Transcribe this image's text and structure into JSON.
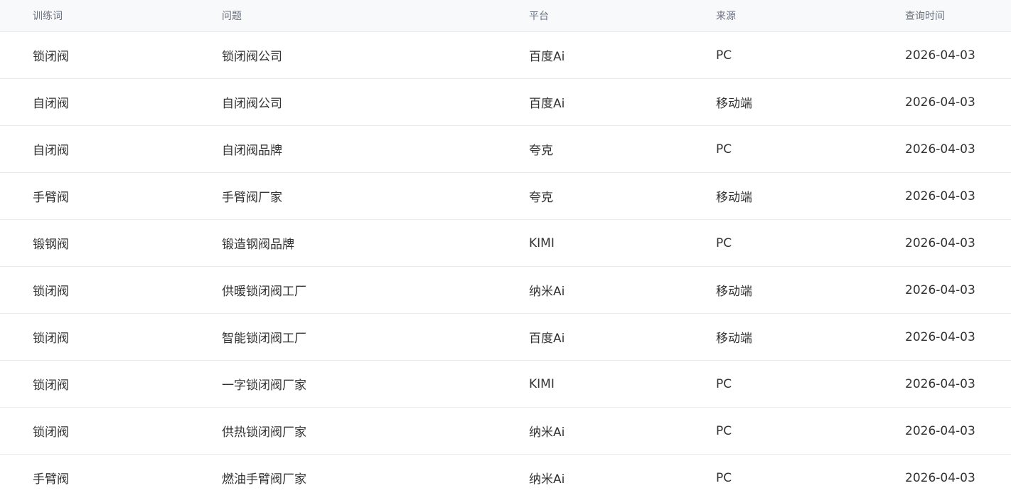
{
  "table": {
    "headers": [
      "训练词",
      "问题",
      "平台",
      "来源",
      "查询时间"
    ],
    "rows": [
      [
        "锁闭阀",
        "锁闭阀公司",
        "百度Ai",
        "PC",
        "2026-04-03"
      ],
      [
        "自闭阀",
        "自闭阀公司",
        "百度Ai",
        "移动端",
        "2026-04-03"
      ],
      [
        "自闭阀",
        "自闭阀品牌",
        "夸克",
        "PC",
        "2026-04-03"
      ],
      [
        "手臂阀",
        "手臂阀厂家",
        "夸克",
        "移动端",
        "2026-04-03"
      ],
      [
        "锻钢阀",
        "锻造钢阀品牌",
        "KIMI",
        "PC",
        "2026-04-03"
      ],
      [
        "锁闭阀",
        "供暖锁闭阀工厂",
        "纳米Ai",
        "移动端",
        "2026-04-03"
      ],
      [
        "锁闭阀",
        "智能锁闭阀工厂",
        "百度Ai",
        "移动端",
        "2026-04-03"
      ],
      [
        "锁闭阀",
        "一字锁闭阀厂家",
        "KIMI",
        "PC",
        "2026-04-03"
      ],
      [
        "锁闭阀",
        "供热锁闭阀厂家",
        "纳米Ai",
        "PC",
        "2026-04-03"
      ],
      [
        "手臂阀",
        "燃油手臂阀厂家",
        "纳米Ai",
        "PC",
        "2026-04-03"
      ]
    ]
  }
}
